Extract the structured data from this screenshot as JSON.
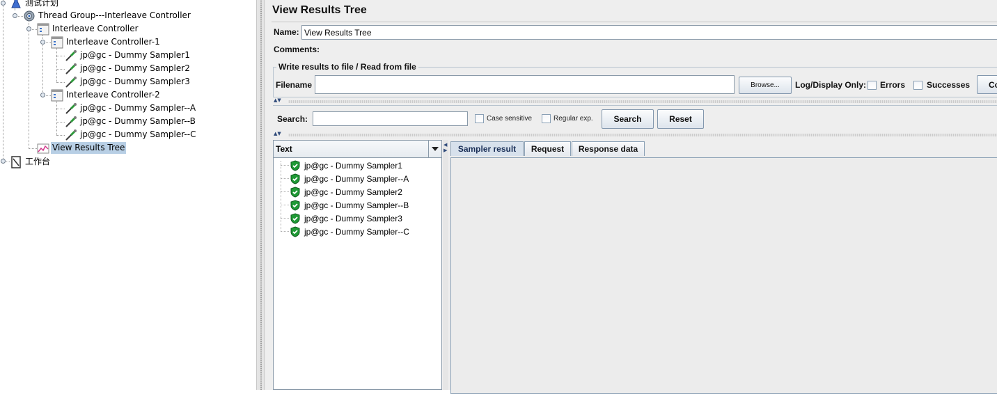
{
  "tree": {
    "nodes": [
      {
        "label": "测试计划",
        "icon": "test-plan-icon"
      },
      {
        "label": "Thread Group---Interleave Controller",
        "icon": "thread-group-gear-icon"
      },
      {
        "label": "Interleave Controller",
        "icon": "logic-controller-icon"
      },
      {
        "label": "Interleave Controller-1",
        "icon": "logic-controller-icon"
      },
      {
        "label": "jp@gc - Dummy Sampler1",
        "icon": "sampler-pipette-icon"
      },
      {
        "label": "jp@gc - Dummy Sampler2",
        "icon": "sampler-pipette-icon"
      },
      {
        "label": "jp@gc - Dummy Sampler3",
        "icon": "sampler-pipette-icon"
      },
      {
        "label": "Interleave Controller-2",
        "icon": "logic-controller-icon"
      },
      {
        "label": "jp@gc - Dummy Sampler--A",
        "icon": "sampler-pipette-icon"
      },
      {
        "label": "jp@gc - Dummy Sampler--B",
        "icon": "sampler-pipette-icon"
      },
      {
        "label": "jp@gc - Dummy Sampler--C",
        "icon": "sampler-pipette-icon"
      },
      {
        "label": "View Results Tree",
        "icon": "listener-graph-icon",
        "selected": true
      },
      {
        "label": "工作台",
        "icon": "workbench-icon"
      }
    ]
  },
  "panel": {
    "title": "View Results Tree",
    "name_label": "Name:",
    "name_value": "View Results Tree",
    "comments_label": "Comments:",
    "file_group_title": "Write results to file / Read from file",
    "filename_label": "Filename",
    "filename_value": "",
    "browse_label": "Browse...",
    "log_display_label": "Log/Display Only:",
    "errors_label": "Errors",
    "successes_label": "Successes",
    "configure_label": "Co"
  },
  "search": {
    "label": "Search:",
    "value": "",
    "case_sensitive_label": "Case sensitive",
    "regular_exp_label": "Regular exp.",
    "search_button": "Search",
    "reset_button": "Reset"
  },
  "results": {
    "renderer_label": "Text",
    "items": [
      "jp@gc - Dummy Sampler1",
      "jp@gc - Dummy Sampler--A",
      "jp@gc - Dummy Sampler2",
      "jp@gc - Dummy Sampler--B",
      "jp@gc - Dummy Sampler3",
      "jp@gc - Dummy Sampler--C"
    ],
    "item_status_icon": "success-shield-check-icon"
  },
  "tabs": [
    "Sampler result",
    "Request",
    "Response data"
  ],
  "colors": {
    "selection": "#b8cfe5",
    "panel_bg": "#eeeeee",
    "success_green": "#1f9a35",
    "active_tab": "#d7e1ec"
  }
}
